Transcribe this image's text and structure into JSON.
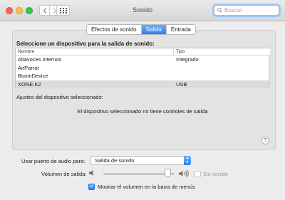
{
  "window": {
    "title": "Sonido"
  },
  "search": {
    "placeholder": "Buscar"
  },
  "tabs": [
    {
      "label": "Efectos de sonido",
      "active": false
    },
    {
      "label": "Salida",
      "active": true
    },
    {
      "label": "Entrada",
      "active": false
    }
  ],
  "output": {
    "heading": "Seleccione un dispositivo para la salida de sonido:",
    "columns": {
      "name": "Nombre",
      "type": "Tipo"
    },
    "devices": [
      {
        "name": "Altavoces internos",
        "type": "Integrado",
        "selected": false
      },
      {
        "name": "AirParrot",
        "type": "",
        "selected": false
      },
      {
        "name": "BoomDevice",
        "type": "",
        "selected": false
      },
      {
        "name": "XONE:K2",
        "type": "USB",
        "selected": true
      }
    ],
    "settings_label": "Ajustes del dispositivo seleccionado:",
    "no_controls_text": "El dispositivo seleccionado no tiene controles de salida"
  },
  "help_label": "?",
  "bottom": {
    "port_label": "Usar puerto de audio para:",
    "port_value": "Salida de sonido",
    "volume_label": "Volumen de salida:",
    "volume_level": 0.95,
    "mute_label": "Sin sonido",
    "mute_checked": false,
    "menu_bar_label": "Mostrar el volumen en la barra de menús",
    "menu_bar_checked": true
  },
  "colors": {
    "accent": "#2c7ff0",
    "close": "#fc615d",
    "minimize": "#fdbc40",
    "maximize": "#34c84a"
  },
  "icons": [
    "back-icon",
    "forward-icon",
    "grid-icon",
    "search-icon",
    "speaker-low-icon",
    "speaker-high-icon",
    "checkmark-icon",
    "chevron-updown-icon"
  ]
}
